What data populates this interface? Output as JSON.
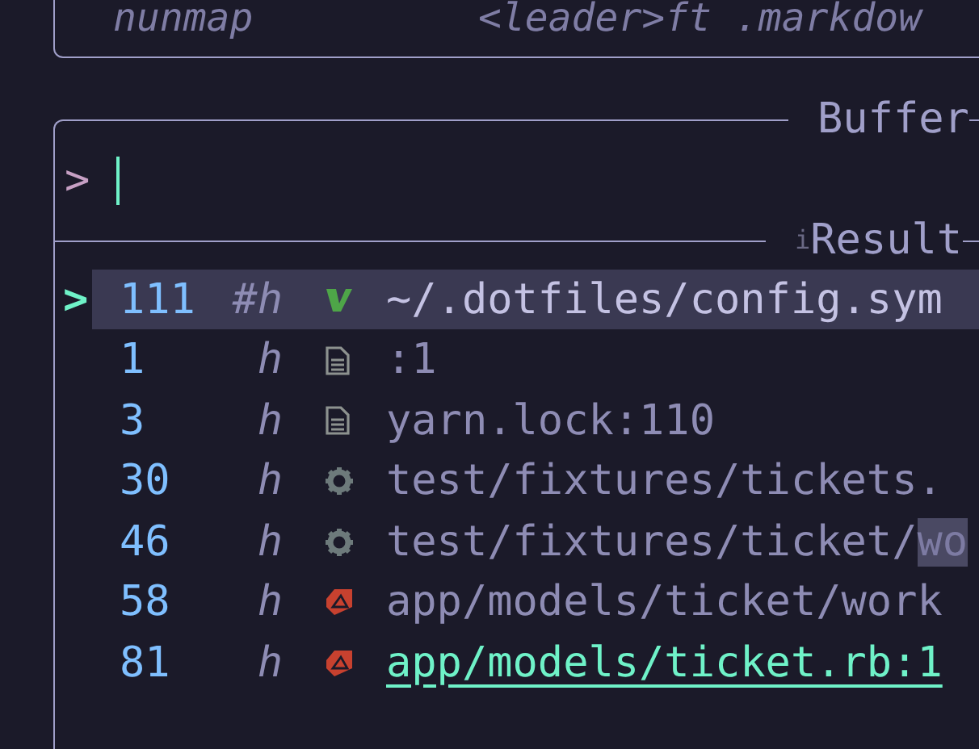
{
  "keymap_panel": {
    "mode": "nunmap",
    "mapping": "<leader>ft .markdow"
  },
  "picker": {
    "title": "Buffer",
    "prompt": {
      "symbol": ">"
    },
    "results": {
      "title_prefix": "i",
      "title": "Result",
      "pointer": ">",
      "rows": [
        {
          "number": "111",
          "flags": "#h",
          "kind": "vim",
          "path": "~/.dotfiles/config.sym",
          "selected": true,
          "current": false
        },
        {
          "number": "1",
          "flags": "h",
          "kind": "file",
          "path": ":1",
          "selected": false,
          "current": false
        },
        {
          "number": "3",
          "flags": "h",
          "kind": "file",
          "path": "yarn.lock:110",
          "selected": false,
          "current": false
        },
        {
          "number": "30",
          "flags": "h",
          "kind": "gear",
          "path": "test/fixtures/tickets.",
          "selected": false,
          "current": false
        },
        {
          "number": "46",
          "flags": "h",
          "kind": "gear",
          "path": "test/fixtures/ticket/",
          "highlight": "wo",
          "selected": false,
          "current": false
        },
        {
          "number": "58",
          "flags": "h",
          "kind": "ruby",
          "path": "app/models/ticket/work",
          "selected": false,
          "current": false
        },
        {
          "number": "81",
          "flags": "h",
          "kind": "ruby",
          "path": "app/models/ticket.rb:1",
          "selected": false,
          "current": true
        }
      ]
    }
  }
}
